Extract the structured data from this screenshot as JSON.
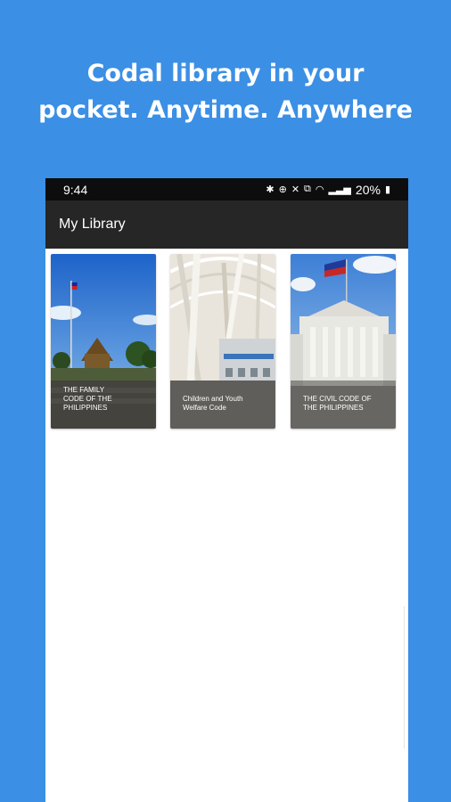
{
  "promo": {
    "line1": "Codal library in your",
    "line2": "pocket. Anytime. Anywhere"
  },
  "status_bar": {
    "time": "9:44",
    "icons": [
      "bluetooth-icon",
      "data-saver-icon",
      "mute-icon",
      "vibrate-icon",
      "wifi-icon",
      "signal-icon",
      "battery-icon"
    ],
    "battery": "20%"
  },
  "app_bar": {
    "title": "My Library"
  },
  "library": {
    "books": [
      {
        "title_lines": [
          "THE FAMILY",
          "CODE OF THE",
          "PHILIPPINES"
        ]
      },
      {
        "title_lines": [
          "Children and Youth",
          "Welfare Code"
        ]
      },
      {
        "title_lines": [
          "THE CIVIL CODE OF",
          "THE PHILIPPINES"
        ]
      }
    ]
  },
  "colors": {
    "background": "#3b8fe5",
    "status_bar": "#0d0d0d",
    "app_bar": "#262626",
    "content": "#ffffff"
  }
}
